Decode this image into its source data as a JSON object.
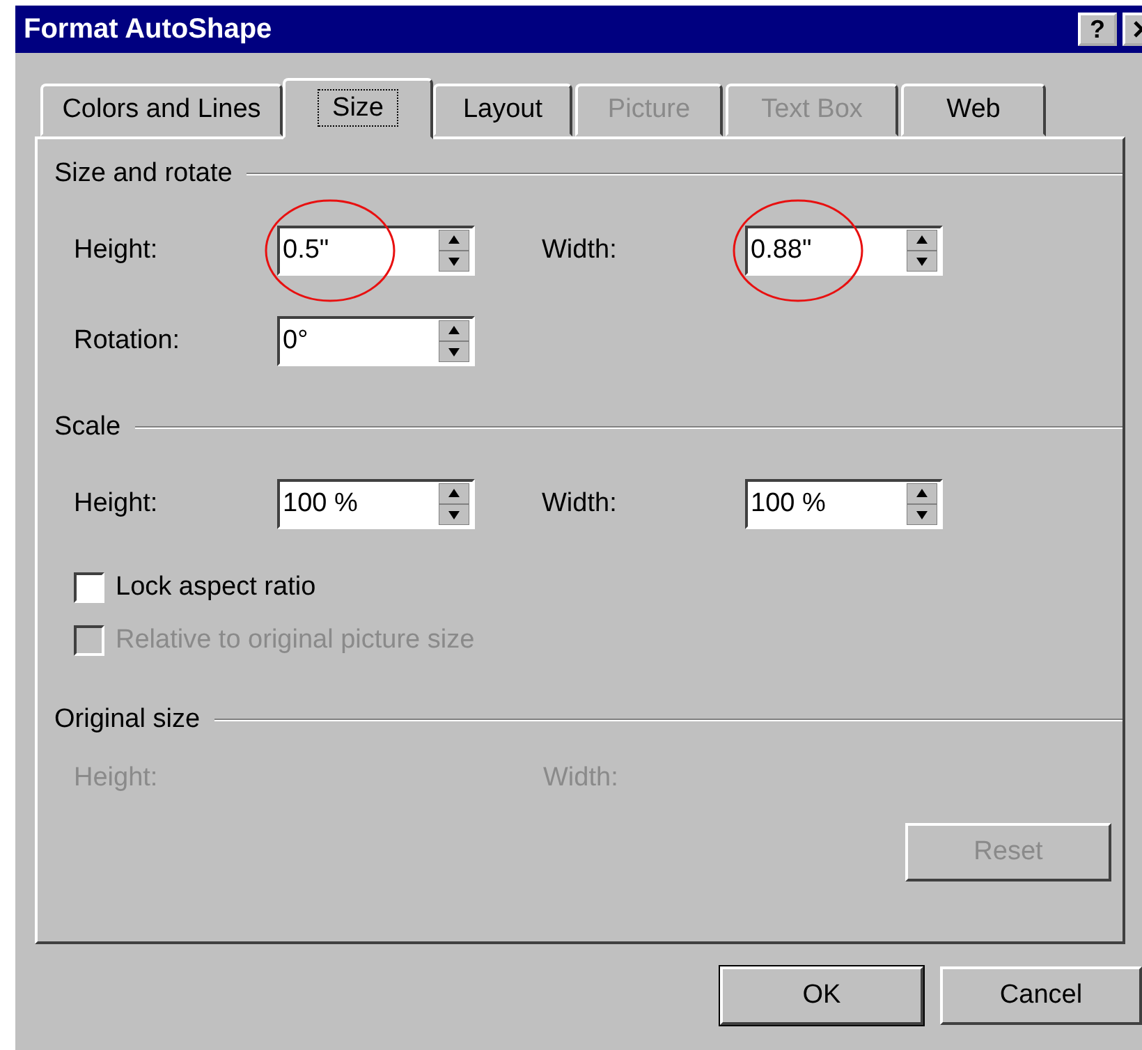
{
  "window": {
    "title": "Format AutoShape",
    "help_button": "?"
  },
  "tabs": [
    {
      "label": "Colors and Lines",
      "selected": false,
      "disabled": false
    },
    {
      "label": "Size",
      "selected": true,
      "disabled": false
    },
    {
      "label": "Layout",
      "selected": false,
      "disabled": false
    },
    {
      "label": "Picture",
      "selected": false,
      "disabled": true
    },
    {
      "label": "Text Box",
      "selected": false,
      "disabled": true
    },
    {
      "label": "Web",
      "selected": false,
      "disabled": false
    }
  ],
  "sections": [
    {
      "title": "Size and rotate",
      "rows": [
        [
          {
            "kind": "spin",
            "label": "Height:",
            "value": "0.5\"",
            "circled": true,
            "disabled": false
          },
          {
            "kind": "spin",
            "label": "Width:",
            "value": "0.88\"",
            "circled": true,
            "disabled": false
          }
        ],
        [
          {
            "kind": "spin",
            "label": "Rotation:",
            "value": "0°",
            "circled": false,
            "disabled": false
          }
        ]
      ]
    },
    {
      "title": "Scale",
      "rows": [
        [
          {
            "kind": "spin",
            "label": "Height:",
            "value": "100 %",
            "circled": false,
            "disabled": false
          },
          {
            "kind": "spin",
            "label": "Width:",
            "value": "100 %",
            "circled": false,
            "disabled": false
          }
        ],
        [
          {
            "kind": "checkbox",
            "label": "Lock aspect ratio",
            "checked": false,
            "disabled": false
          }
        ],
        [
          {
            "kind": "checkbox",
            "label": "Relative to original picture size",
            "checked": false,
            "disabled": true
          }
        ]
      ]
    },
    {
      "title": "Original size",
      "rows": [
        [
          {
            "kind": "text",
            "label": "Height:",
            "disabled": true
          },
          {
            "kind": "text",
            "label": "Width:",
            "disabled": true
          }
        ]
      ]
    }
  ],
  "reset_button": {
    "label": "Reset",
    "disabled": true
  },
  "buttons": [
    "OK",
    "Cancel"
  ]
}
